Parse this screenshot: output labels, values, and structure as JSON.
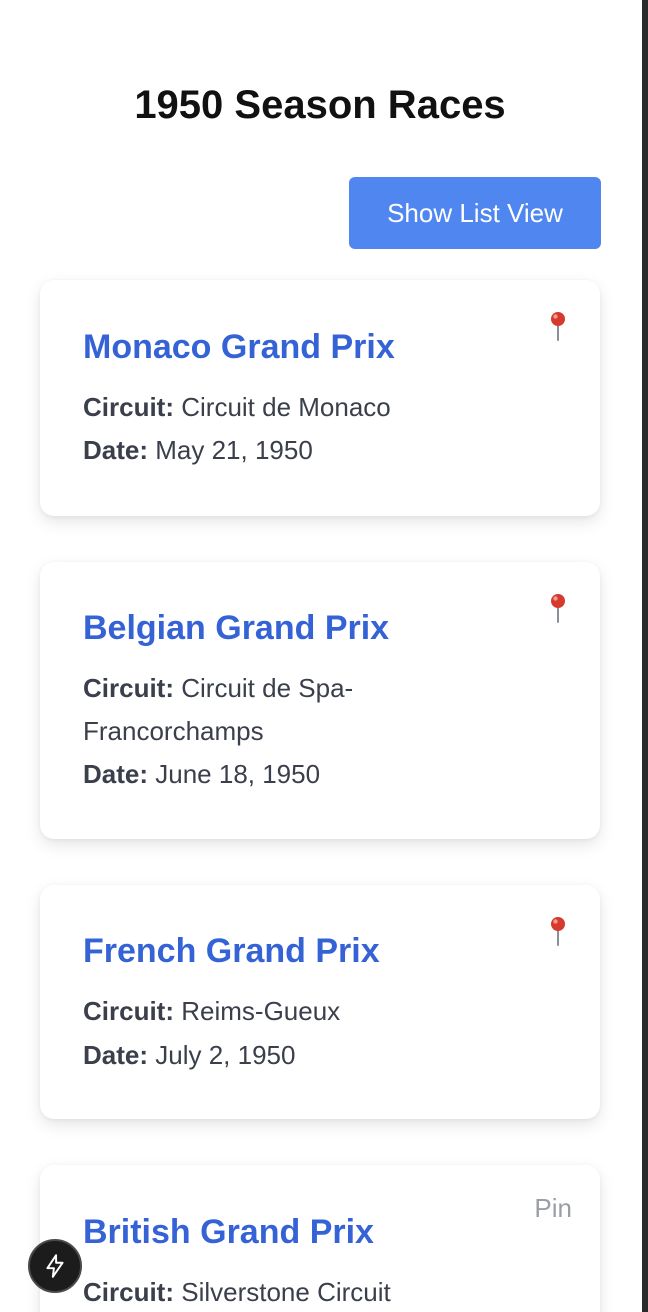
{
  "page": {
    "title": "1950 Season Races"
  },
  "toolbar": {
    "toggle_view_label": "Show List View"
  },
  "labels": {
    "circuit": "Circuit:",
    "date": "Date:"
  },
  "races": [
    {
      "name": "Monaco Grand Prix",
      "circuit": "Circuit de Monaco",
      "date": "May 21, 1950",
      "pin": "pin-icon"
    },
    {
      "name": "Belgian Grand Prix",
      "circuit_line1": "Circuit de Spa-",
      "circuit_line2": "Francorchamps",
      "date": "June 18, 1950",
      "pin": "pin-icon"
    },
    {
      "name": "French Grand Prix",
      "circuit": "Reims-Gueux",
      "date": "July 2, 1950",
      "pin": "pin-icon"
    },
    {
      "name": "British Grand Prix",
      "circuit": "Silverstone Circuit",
      "pin_label": "Pin"
    }
  ],
  "colors": {
    "accent": "#4f86f0",
    "race_title": "#3563d6",
    "text": "#3a3f4b",
    "pin_red": "#d63a2f"
  }
}
